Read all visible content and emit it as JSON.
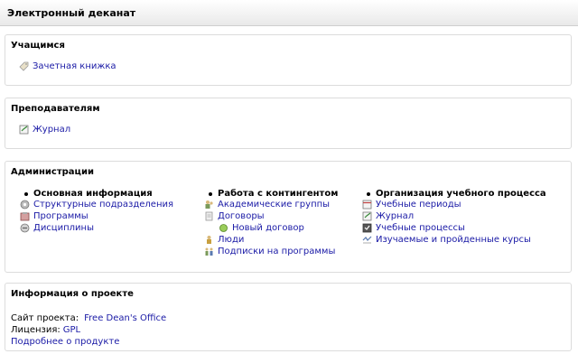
{
  "app_title": "Электронный деканат",
  "students": {
    "heading": "Учащимся",
    "items": [
      {
        "label": "Зачетная книжка",
        "icon": "tag-icon"
      }
    ]
  },
  "teachers": {
    "heading": "Преподавателям",
    "items": [
      {
        "label": "Журнал",
        "icon": "journal-icon"
      }
    ]
  },
  "admin": {
    "heading": "Администрации",
    "col1": {
      "title": "Основная информация",
      "items": [
        {
          "label": "Структурные подразделения",
          "icon": "structure-icon"
        },
        {
          "label": "Программы",
          "icon": "programs-icon"
        },
        {
          "label": "Дисциплины",
          "icon": "disciplines-icon"
        }
      ]
    },
    "col2": {
      "title": "Работа с контингентом",
      "items": [
        {
          "label": "Академические группы",
          "icon": "group-icon"
        },
        {
          "label": "Договоры",
          "icon": "contract-icon"
        },
        {
          "label": "Новый договор",
          "icon": "new-contract-icon"
        },
        {
          "label": "Люди",
          "icon": "people-icon"
        },
        {
          "label": "Подписки на программы",
          "icon": "subscriptions-icon"
        }
      ]
    },
    "col3": {
      "title": "Организация учебного процесса",
      "items": [
        {
          "label": "Учебные периоды",
          "icon": "periods-icon"
        },
        {
          "label": "Журнал",
          "icon": "journal-icon"
        },
        {
          "label": "Учебные процессы",
          "icon": "processes-icon"
        },
        {
          "label": "Изучаемые и пройденные курсы",
          "icon": "courses-icon"
        }
      ]
    }
  },
  "project": {
    "heading": "Информация о проекте",
    "site_label": "Сайт проекта:",
    "site_link": "Free Dean's Office",
    "license_label": "Лицензия:",
    "license_link": "GPL",
    "more_link": "Подробнее о продукте"
  },
  "colors": {
    "link": "#1a1aa6",
    "border": "#dcdcdc"
  }
}
